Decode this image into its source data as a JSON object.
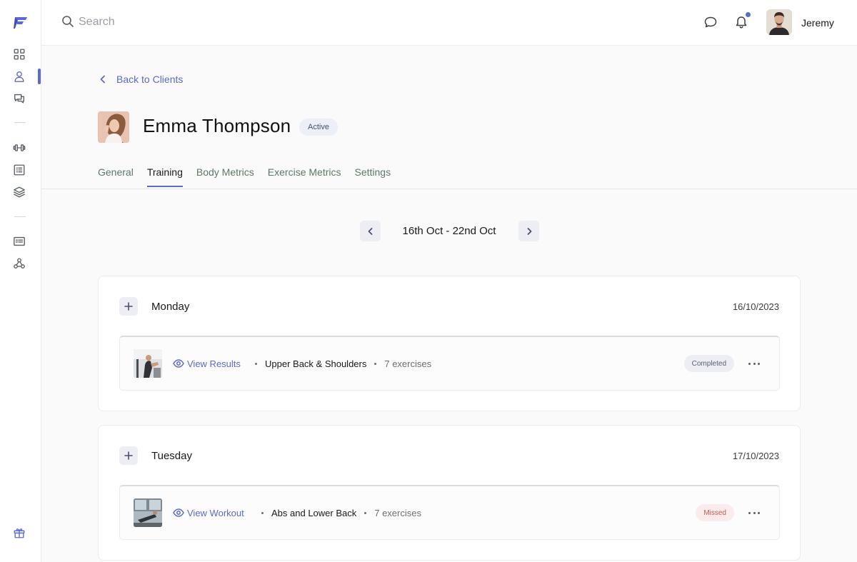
{
  "header": {
    "search_placeholder": "Search",
    "user_name": "Jeremy"
  },
  "sidebar": {
    "items": [
      {
        "icon": "dashboard-icon"
      },
      {
        "icon": "clients-icon",
        "active": true
      },
      {
        "icon": "messages-icon"
      },
      {
        "icon": "dumbbell-icon"
      },
      {
        "icon": "list-icon"
      },
      {
        "icon": "layers-icon"
      },
      {
        "icon": "id-card-icon"
      },
      {
        "icon": "webhook-icon"
      }
    ],
    "bottom_icon": "gift-icon"
  },
  "back_link": "Back to Clients",
  "client": {
    "name": "Emma Thompson",
    "status": "Active"
  },
  "tabs": [
    {
      "label": "General",
      "active": false
    },
    {
      "label": "Training",
      "active": true
    },
    {
      "label": "Body Metrics",
      "active": false
    },
    {
      "label": "Exercise Metrics",
      "active": false
    },
    {
      "label": "Settings",
      "active": false
    }
  ],
  "week": {
    "label": "16th Oct - 22nd Oct"
  },
  "days": [
    {
      "name": "Monday",
      "date": "16/10/2023",
      "workout": {
        "action": "View Results",
        "title": "Upper Back & Shoulders",
        "exercises": "7 exercises",
        "status": "Completed"
      }
    },
    {
      "name": "Tuesday",
      "date": "17/10/2023",
      "workout": {
        "action": "View Workout",
        "title": "Abs and Lower Back",
        "exercises": "7 exercises",
        "status": "Missed"
      }
    }
  ],
  "colors": {
    "accent": "#5b6ad0",
    "tab_inactive": "#5d7a66",
    "missed": "#c65b54"
  }
}
